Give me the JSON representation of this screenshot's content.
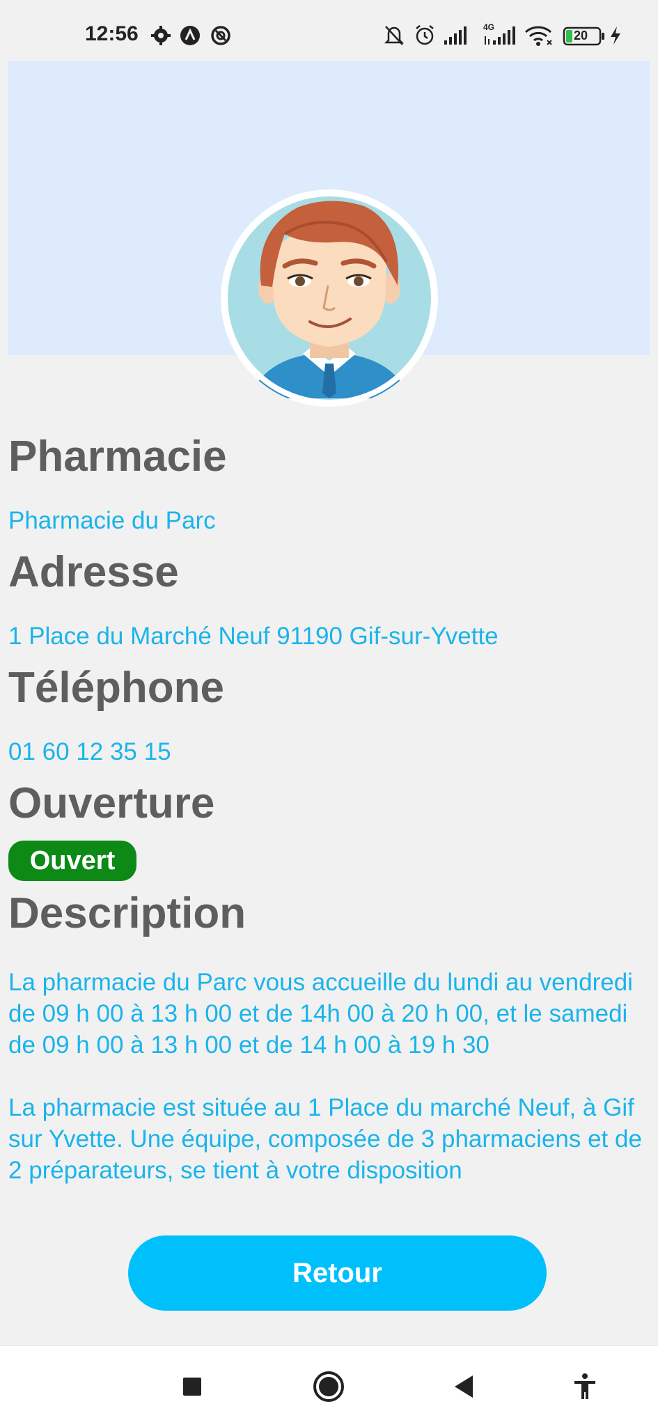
{
  "status_bar": {
    "time": "12:56",
    "left_icons": [
      "gear-icon",
      "app-icon-a",
      "app-icon-at"
    ],
    "right_icons": [
      "mute-icon",
      "alarm-icon",
      "signal-icon",
      "4g-signal-icon",
      "wifi-icon",
      "battery-icon",
      "charging-icon"
    ],
    "network_label": "4G",
    "battery_level": "20"
  },
  "header": {
    "banner_color": "#ddebfd",
    "avatar_icon": "pharmacist-avatar"
  },
  "sections": {
    "pharmacie": {
      "title": "Pharmacie",
      "value": "Pharmacie du Parc"
    },
    "adresse": {
      "title": "Adresse",
      "value": "1 Place du Marché Neuf 91190 Gif-sur-Yvette"
    },
    "telephone": {
      "title": "Téléphone",
      "value": "01 60 12 35 15"
    },
    "ouverture": {
      "title": "Ouverture",
      "status": "Ouvert",
      "status_color": "#0d8a16"
    },
    "description": {
      "title": "Description",
      "paragraph1": "La pharmacie du Parc vous accueille du lundi au vendredi de 09 h 00 à 13 h 00 et de 14h 00 à 20 h 00, et le samedi de 09 h 00 à 13 h 00 et de 14 h 00 à 19 h 30",
      "paragraph2": "La pharmacie est située au 1 Place du marché Neuf, à Gif sur Yvette. Une équipe, composée de 3 pharmaciens et de 2 préparateurs, se tient à votre disposition"
    }
  },
  "actions": {
    "back_label": "Retour",
    "accent_color": "#00c0fc"
  },
  "nav_bar": {
    "icons": [
      "recents-square-icon",
      "home-circle-icon",
      "back-triangle-icon",
      "accessibility-icon"
    ]
  }
}
